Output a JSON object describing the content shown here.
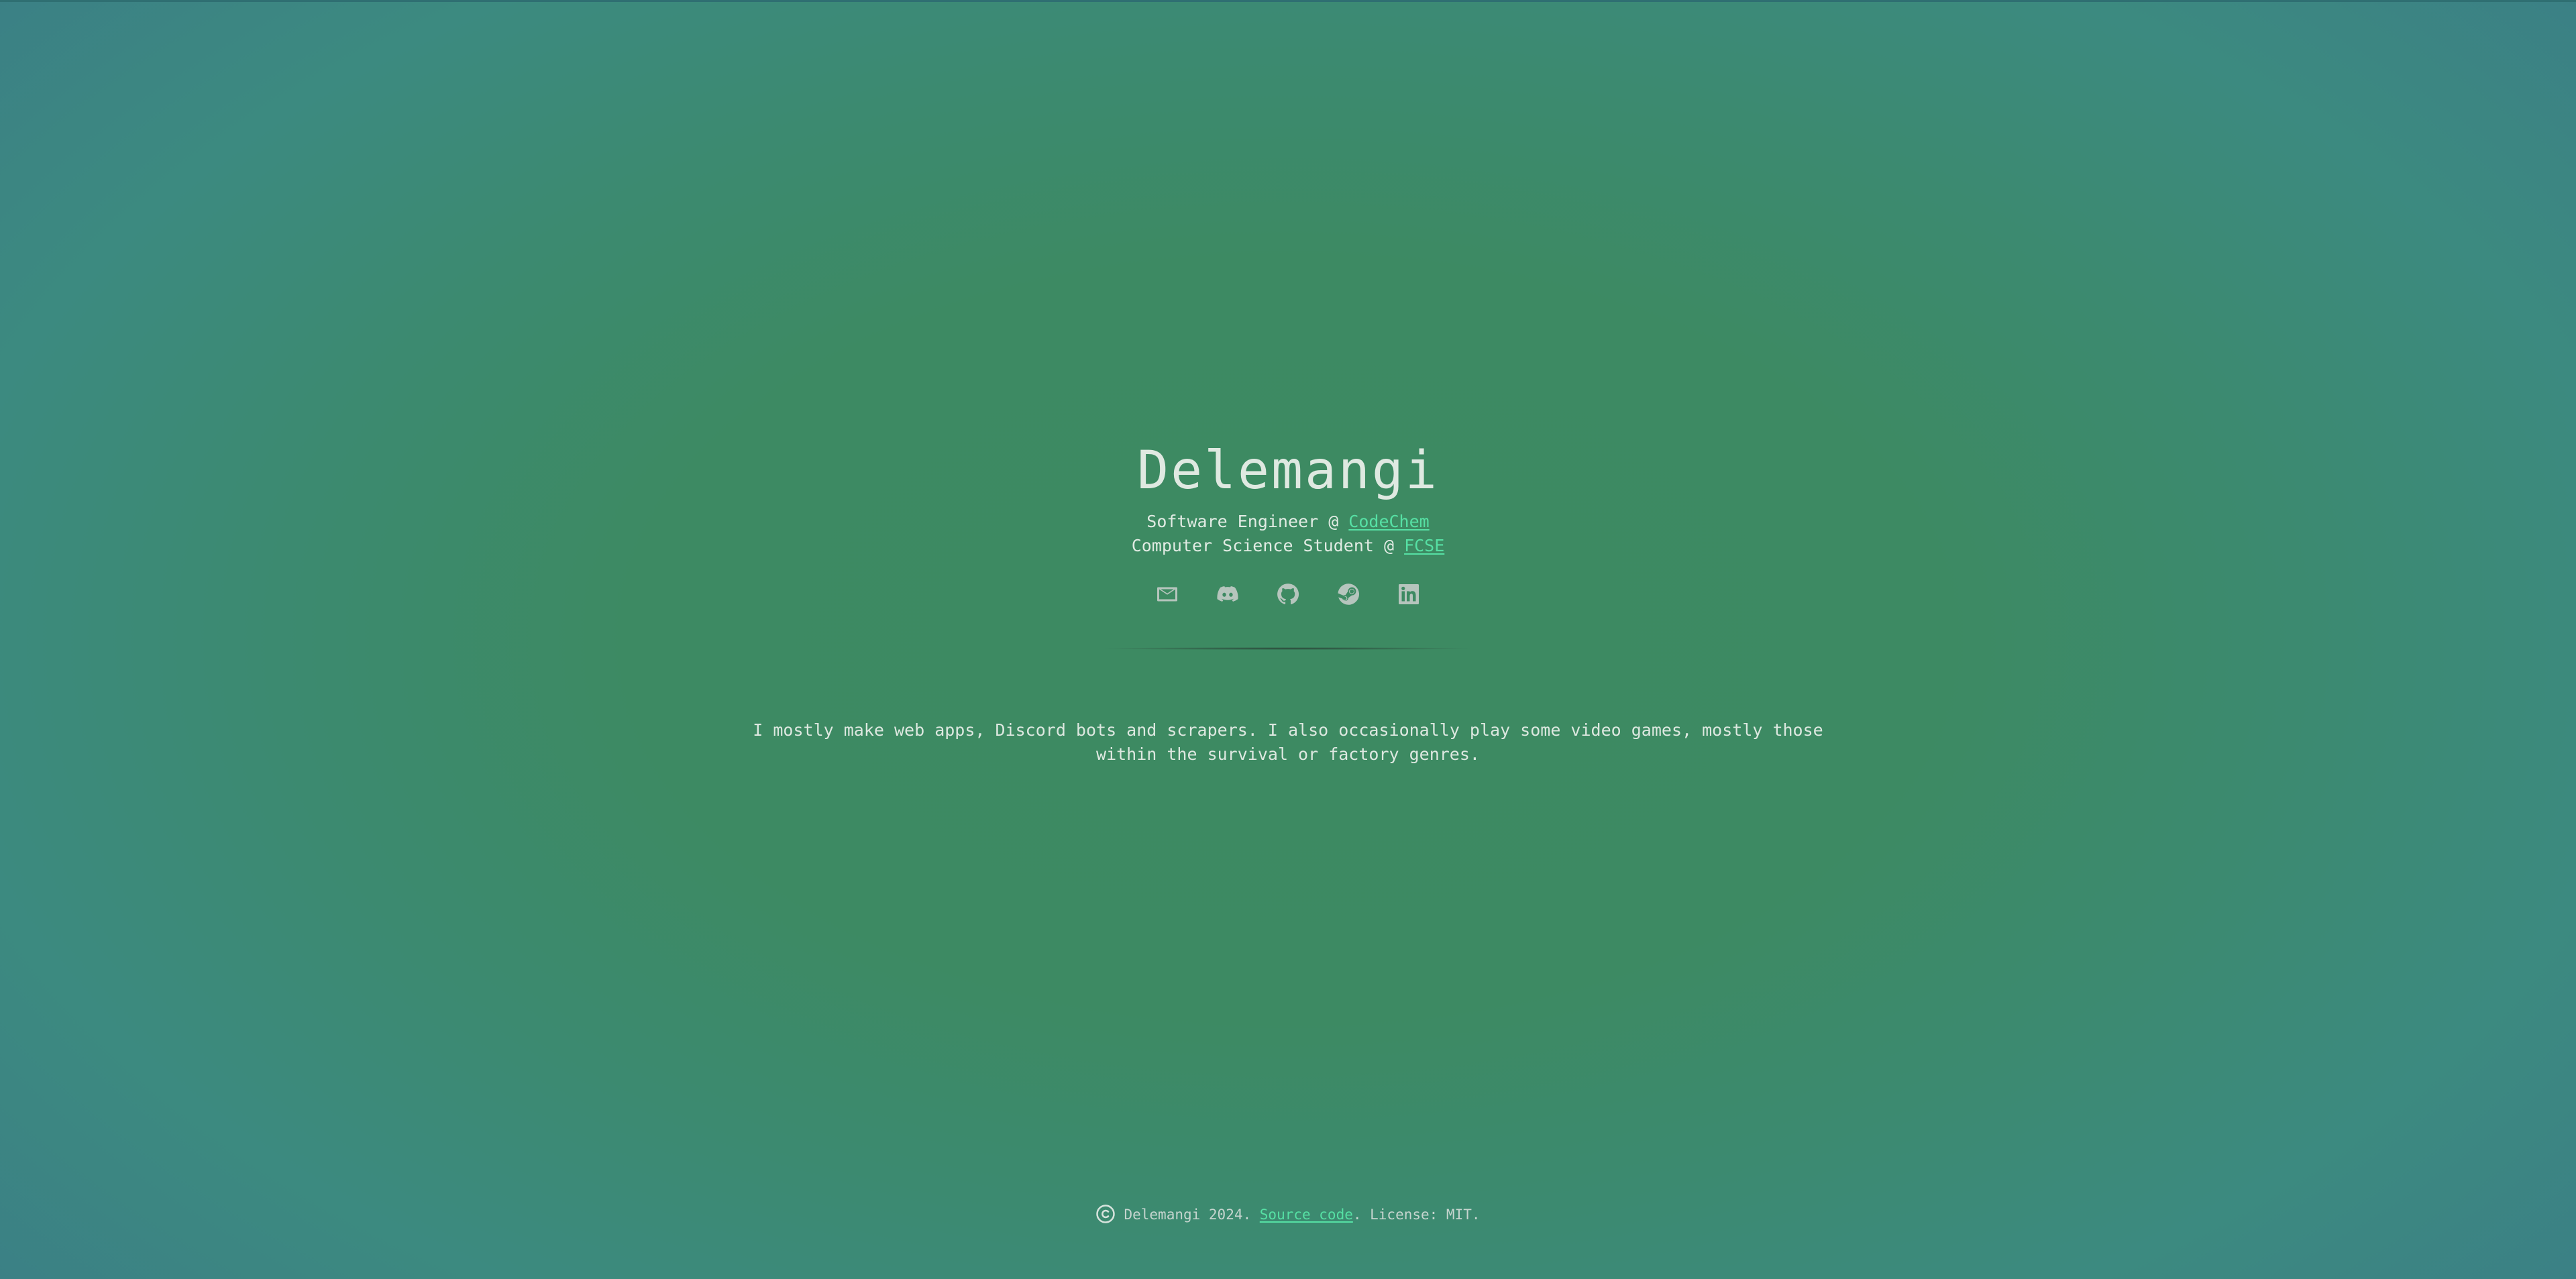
{
  "hero": {
    "name": "Delemangi",
    "line1": {
      "prefix": "Software Engineer @ ",
      "link": "CodeChem"
    },
    "line2": {
      "prefix": "Computer Science Student @ ",
      "link": "FCSE"
    }
  },
  "socials": [
    {
      "icon": "mail-icon"
    },
    {
      "icon": "discord-icon"
    },
    {
      "icon": "github-icon"
    },
    {
      "icon": "steam-icon"
    },
    {
      "icon": "linkedin-icon"
    }
  ],
  "bio": "I mostly make web apps, Discord bots and scrapers. I also occasionally play some video games, mostly those within the survival or factory genres.",
  "footer": {
    "text_before": "Delemangi 2024. ",
    "source_link": "Source code",
    "text_after": ". License: MIT."
  },
  "colors": {
    "accent_link": "#56e0a4",
    "text": "#e3ece5",
    "icon": "#b6c5bd",
    "background_center": "#3d8a62",
    "background_edge": "#3b7f86"
  }
}
